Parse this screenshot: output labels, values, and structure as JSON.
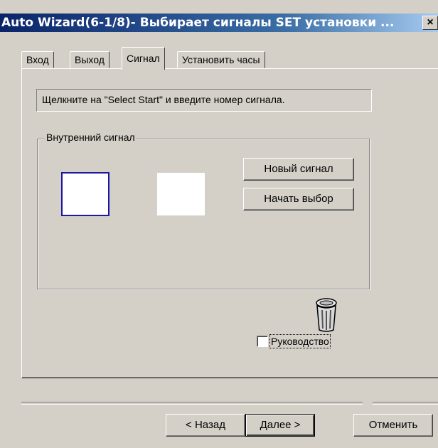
{
  "window": {
    "title": "Auto Wizard(6-1/8)- Выбирает сигналы SET установки ...",
    "close_glyph": "×"
  },
  "tabs": [
    {
      "label": "Вход"
    },
    {
      "label": "Выход"
    },
    {
      "label": "Сигнал"
    },
    {
      "label": "Установить часы"
    }
  ],
  "instruction": "Щелкните на \"Select Start\" и введите номер сигнала.",
  "group": {
    "title": "Внутренний сигнал",
    "new_signal_label": "Новый сигнал",
    "start_select_label": "Начать выбор"
  },
  "guide": {
    "label": "Руководство",
    "checked": false
  },
  "footer": {
    "back_label": "< Назад",
    "next_label": "Далее >",
    "cancel_label": "Отменить"
  },
  "icons": {
    "trash": "trash-icon"
  }
}
